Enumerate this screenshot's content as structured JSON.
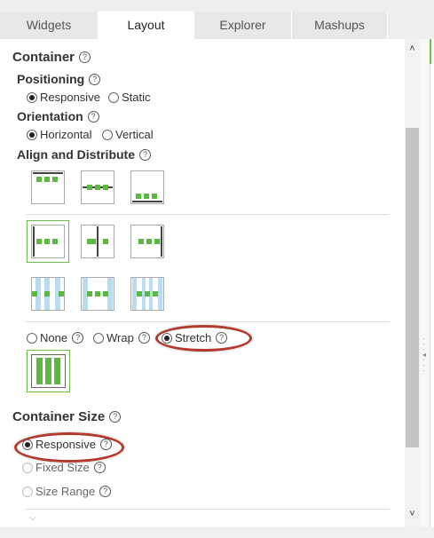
{
  "tabs": [
    {
      "label": "Widgets",
      "active": false
    },
    {
      "label": "Layout",
      "active": true
    },
    {
      "label": "Explorer",
      "active": false
    },
    {
      "label": "Mashups",
      "active": false
    }
  ],
  "container": {
    "title": "Container",
    "positioning": {
      "label": "Positioning",
      "options": [
        "Responsive",
        "Static"
      ],
      "selected": "Responsive"
    },
    "orientation": {
      "label": "Orientation",
      "options": [
        "Horizontal",
        "Vertical"
      ],
      "selected": "Horizontal"
    },
    "align": {
      "label": "Align and Distribute"
    },
    "wrap": {
      "options": [
        "None",
        "Wrap",
        "Stretch"
      ],
      "selected": "Stretch"
    }
  },
  "container_size": {
    "title": "Container Size",
    "options": [
      "Responsive",
      "Fixed Size",
      "Size Range"
    ],
    "selected": "Responsive"
  },
  "help_glyph": "?",
  "colors": {
    "accent_green": "#5ab93e",
    "highlight_red": "#b23a2e",
    "stretch_blue": "#b8dcf2"
  }
}
